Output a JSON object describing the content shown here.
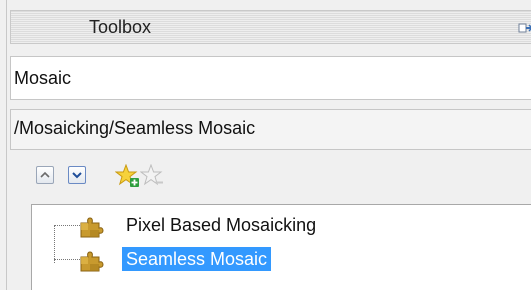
{
  "panel": {
    "title": "Toolbox"
  },
  "search": {
    "value": "Mosaic"
  },
  "path": {
    "text": "/Mosaicking/Seamless Mosaic"
  },
  "toolbar": {
    "icons": [
      "collapse-up-icon",
      "expand-down-icon",
      "add-favorite-icon",
      "remove-favorite-icon"
    ]
  },
  "tree": {
    "items": [
      {
        "label": "Pixel Based Mosaicking",
        "icon": "puzzle-icon",
        "selected": false
      },
      {
        "label": "Seamless Mosaic",
        "icon": "puzzle-icon",
        "selected": true
      }
    ]
  },
  "colors": {
    "selection": "#3399ff",
    "background": "#f0f0f0"
  }
}
